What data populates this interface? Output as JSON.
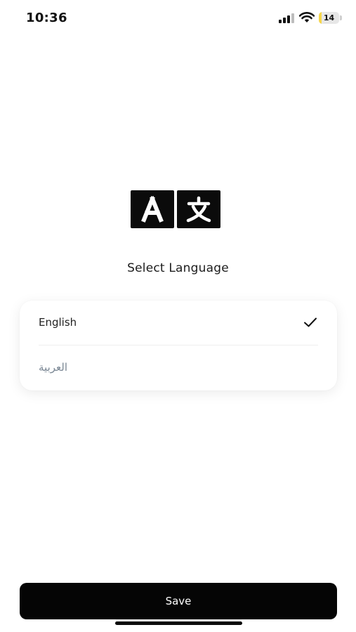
{
  "status_bar": {
    "time": "10:36",
    "battery_level": "14",
    "battery_fraction": 0.14,
    "battery_color": "#f6d64a",
    "icons": [
      "cellular-signal-icon",
      "wifi-icon",
      "battery-icon"
    ]
  },
  "header": {
    "icon": "translate-icon",
    "title": "Select Language"
  },
  "languages": {
    "items": [
      {
        "label": "English",
        "selected": true
      },
      {
        "label": "العربية",
        "selected": false
      }
    ],
    "selected_icon": "checkmark-icon"
  },
  "footer": {
    "save_label": "Save",
    "button_color": "#050505"
  }
}
